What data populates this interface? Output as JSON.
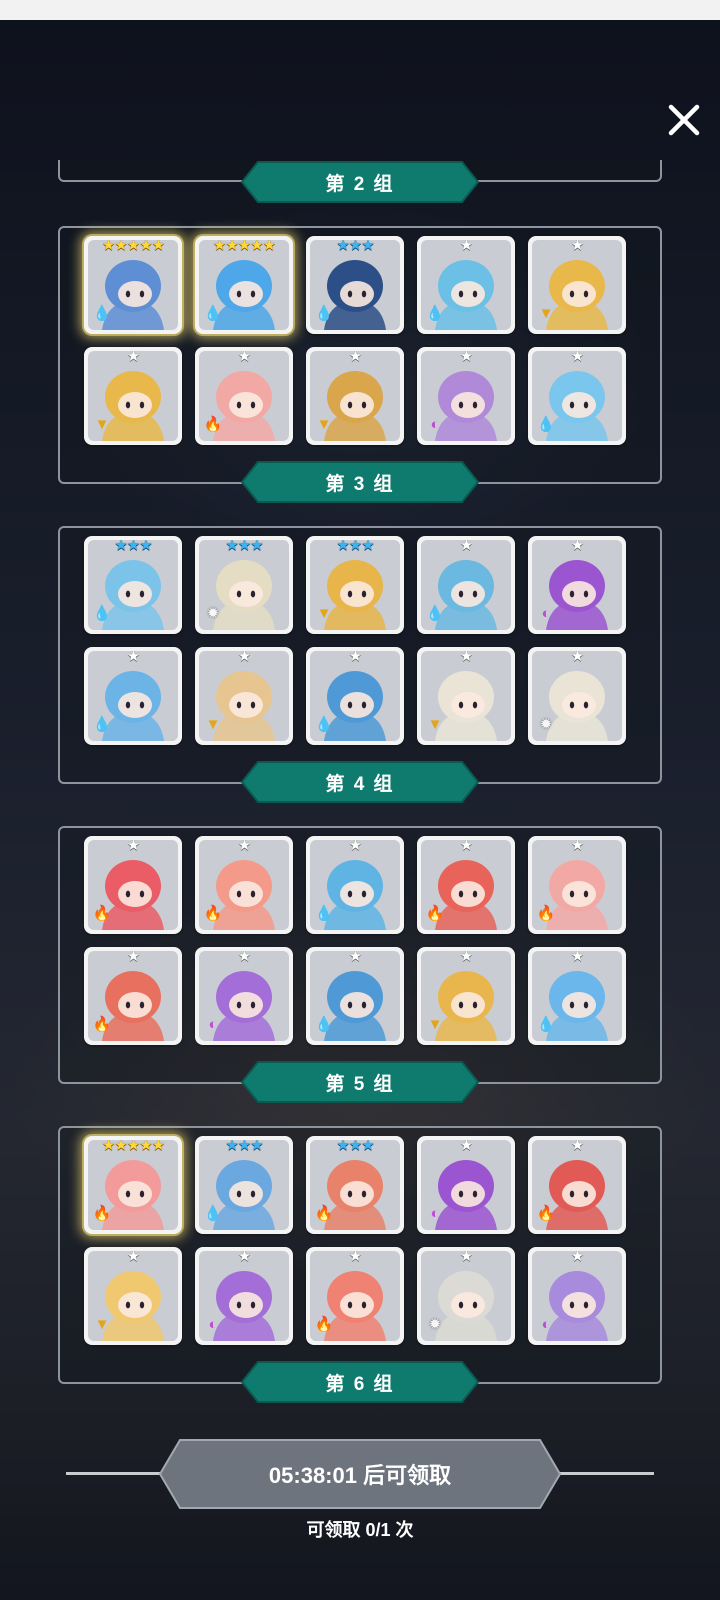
{
  "close_label": "✕",
  "groups": [
    {
      "title": "",
      "cards": []
    },
    {
      "title": "第 2 组",
      "cards": [
        {
          "stars": "★★★★★",
          "star_color": "gold",
          "element": "water",
          "icon": "blue-armored-beast",
          "color": "#5e8fd4",
          "highlight": true
        },
        {
          "stars": "★★★★★",
          "star_color": "gold",
          "element": "water",
          "icon": "blue-horned-girl",
          "color": "#4ea7e8",
          "highlight": true
        },
        {
          "stars": "★★★",
          "star_color": "blue",
          "element": "water",
          "icon": "hooded-mage",
          "color": "#2b4f86",
          "highlight": false
        },
        {
          "stars": "★",
          "star_color": "grey",
          "element": "water",
          "icon": "blue-bow-girl",
          "color": "#6cc0e6",
          "highlight": false
        },
        {
          "stars": "★",
          "star_color": "grey",
          "element": "earth",
          "icon": "yellow-skull",
          "color": "#e8b84a",
          "highlight": false
        },
        {
          "stars": "★",
          "star_color": "grey",
          "element": "earth",
          "icon": "yellow-skull",
          "color": "#e8b84a",
          "highlight": false
        },
        {
          "stars": "★",
          "star_color": "grey",
          "element": "fire",
          "icon": "pink-ghost",
          "color": "#f2a9a6",
          "highlight": false
        },
        {
          "stars": "★",
          "star_color": "grey",
          "element": "earth",
          "icon": "witch-hat-girl",
          "color": "#d9a64c",
          "highlight": false
        },
        {
          "stars": "★",
          "star_color": "grey",
          "element": "dark",
          "icon": "purple-hair-maid",
          "color": "#b08ad8",
          "highlight": false
        },
        {
          "stars": "★",
          "star_color": "grey",
          "element": "water",
          "icon": "winged-helmet-girl",
          "color": "#7ac6ec",
          "highlight": false
        }
      ]
    },
    {
      "title": "第 3 组",
      "cards": [
        {
          "stars": "★★★",
          "star_color": "blue",
          "element": "water",
          "icon": "curly-blue-girl",
          "color": "#7cc3ea",
          "highlight": false
        },
        {
          "stars": "★★★",
          "star_color": "blue",
          "element": "light",
          "icon": "white-priest",
          "color": "#e4ddc4",
          "highlight": false
        },
        {
          "stars": "★★★",
          "star_color": "blue",
          "element": "earth",
          "icon": "golden-clock",
          "color": "#e7b54a",
          "highlight": false
        },
        {
          "stars": "★",
          "star_color": "grey",
          "element": "water",
          "icon": "blue-dino",
          "color": "#6bb8e0",
          "highlight": false
        },
        {
          "stars": "★",
          "star_color": "grey",
          "element": "dark",
          "icon": "purple-skull",
          "color": "#9b55d0",
          "highlight": false
        },
        {
          "stars": "★",
          "star_color": "grey",
          "element": "water",
          "icon": "blue-skull",
          "color": "#6cb3e6",
          "highlight": false
        },
        {
          "stars": "★",
          "star_color": "grey",
          "element": "earth",
          "icon": "moai-statue",
          "color": "#e6c590",
          "highlight": false
        },
        {
          "stars": "★",
          "star_color": "grey",
          "element": "water",
          "icon": "blue-pillar",
          "color": "#4f9ad6",
          "highlight": false
        },
        {
          "stars": "★",
          "star_color": "grey",
          "element": "earth",
          "icon": "armored-knight",
          "color": "#e9e4d6",
          "highlight": false
        },
        {
          "stars": "★",
          "star_color": "grey",
          "element": "light",
          "icon": "armored-knight-light",
          "color": "#e9e4d6",
          "highlight": false
        }
      ]
    },
    {
      "title": "第 4 组",
      "cards": [
        {
          "stars": "★",
          "star_color": "grey",
          "element": "fire",
          "icon": "red-hedgehog",
          "color": "#ea5c66",
          "highlight": false
        },
        {
          "stars": "★",
          "star_color": "grey",
          "element": "fire",
          "icon": "bandaged-peach",
          "color": "#f39a8a",
          "highlight": false
        },
        {
          "stars": "★",
          "star_color": "grey",
          "element": "water",
          "icon": "blue-cactus",
          "color": "#5fb4e4",
          "highlight": false
        },
        {
          "stars": "★",
          "star_color": "grey",
          "element": "fire",
          "icon": "flower-monster",
          "color": "#e8645a",
          "highlight": false
        },
        {
          "stars": "★",
          "star_color": "grey",
          "element": "fire",
          "icon": "pink-ghost",
          "color": "#f2a9a6",
          "highlight": false
        },
        {
          "stars": "★",
          "star_color": "grey",
          "element": "fire",
          "icon": "red-castle",
          "color": "#e8705e",
          "highlight": false
        },
        {
          "stars": "★",
          "star_color": "grey",
          "element": "dark",
          "icon": "purple-castle",
          "color": "#a46ed8",
          "highlight": false
        },
        {
          "stars": "★",
          "star_color": "grey",
          "element": "water",
          "icon": "blue-pillar",
          "color": "#4f9ad6",
          "highlight": false
        },
        {
          "stars": "★",
          "star_color": "grey",
          "element": "earth",
          "icon": "golden-lion",
          "color": "#e9b64e",
          "highlight": false
        },
        {
          "stars": "★",
          "star_color": "grey",
          "element": "water",
          "icon": "blue-knight",
          "color": "#6bb6ea",
          "highlight": false
        }
      ]
    },
    {
      "title": "第 5 组",
      "cards": [
        {
          "stars": "★★★★★",
          "star_color": "gold",
          "element": "fire",
          "icon": "pink-bunny-girl",
          "color": "#f29b9a",
          "highlight": true
        },
        {
          "stars": "★★★",
          "star_color": "blue",
          "element": "water",
          "icon": "blue-hair-boy",
          "color": "#6ca8e0",
          "highlight": false
        },
        {
          "stars": "★★★",
          "star_color": "blue",
          "element": "fire",
          "icon": "crowned-queen",
          "color": "#e8826a",
          "highlight": false
        },
        {
          "stars": "★",
          "star_color": "grey",
          "element": "dark",
          "icon": "purple-skull",
          "color": "#9b55d0",
          "highlight": false
        },
        {
          "stars": "★",
          "star_color": "grey",
          "element": "fire",
          "icon": "red-beast",
          "color": "#e25a55",
          "highlight": false
        },
        {
          "stars": "★",
          "star_color": "grey",
          "element": "earth",
          "icon": "fox-girl",
          "color": "#f0c870",
          "highlight": false
        },
        {
          "stars": "★",
          "star_color": "grey",
          "element": "dark",
          "icon": "purple-castle",
          "color": "#a46ed8",
          "highlight": false
        },
        {
          "stars": "★",
          "star_color": "grey",
          "element": "fire",
          "icon": "red-hair-girl",
          "color": "#ef8272",
          "highlight": false
        },
        {
          "stars": "★",
          "star_color": "grey",
          "element": "light",
          "icon": "white-ram",
          "color": "#dcdad4",
          "highlight": false
        },
        {
          "stars": "★",
          "star_color": "grey",
          "element": "dark",
          "icon": "purple-ram",
          "color": "#a88bdc",
          "highlight": false
        }
      ]
    },
    {
      "title": "第 6 组",
      "cards": []
    }
  ],
  "claim_button_label": "05:38:01 后可领取",
  "claim_count_label": "可领取 0/1 次"
}
